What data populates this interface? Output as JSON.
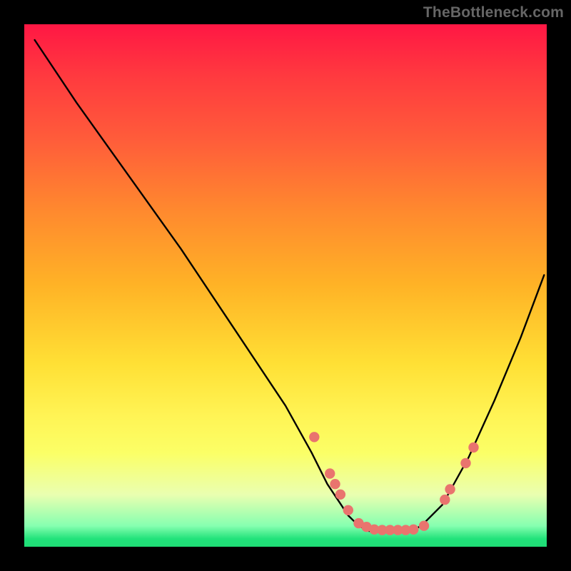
{
  "watermark": "TheBottleneck.com",
  "colors": {
    "background": "#000000",
    "curve_stroke": "#000000",
    "dot_fill": "#e9746e",
    "gradient_top": "#ff1744",
    "gradient_bottom": "#1fdc76"
  },
  "chart_data": {
    "type": "line",
    "title": "",
    "xlabel": "",
    "ylabel": "",
    "xlim": [
      0,
      100
    ],
    "ylim": [
      0,
      100
    ],
    "series": [
      {
        "name": "bottleneck-curve",
        "x": [
          2,
          10,
          20,
          30,
          40,
          50,
          55,
          58,
          62,
          64,
          66,
          68,
          70,
          72,
          74,
          76,
          80,
          85,
          90,
          95,
          99.5
        ],
        "y": [
          97,
          85,
          71,
          57,
          42,
          27,
          18,
          12,
          6,
          4,
          3,
          3,
          3,
          3,
          3,
          4,
          8,
          17,
          28,
          40,
          52
        ]
      }
    ],
    "marker_points": [
      {
        "x": 55.5,
        "y": 21
      },
      {
        "x": 58.5,
        "y": 14
      },
      {
        "x": 59.5,
        "y": 12
      },
      {
        "x": 60.5,
        "y": 10
      },
      {
        "x": 62.0,
        "y": 7
      },
      {
        "x": 64.0,
        "y": 4.5
      },
      {
        "x": 65.5,
        "y": 3.8
      },
      {
        "x": 67.0,
        "y": 3.3
      },
      {
        "x": 68.5,
        "y": 3.2
      },
      {
        "x": 70.0,
        "y": 3.2
      },
      {
        "x": 71.5,
        "y": 3.2
      },
      {
        "x": 73.0,
        "y": 3.2
      },
      {
        "x": 74.5,
        "y": 3.3
      },
      {
        "x": 76.5,
        "y": 4
      },
      {
        "x": 80.5,
        "y": 9
      },
      {
        "x": 81.5,
        "y": 11
      },
      {
        "x": 84.5,
        "y": 16
      },
      {
        "x": 86.0,
        "y": 19
      }
    ]
  }
}
